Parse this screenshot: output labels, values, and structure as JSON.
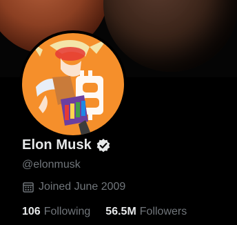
{
  "profile": {
    "display_name": "Elon Musk",
    "handle": "@elonmusk",
    "joined": "Joined June 2009",
    "verified_icon": "verified-badge-icon",
    "calendar_icon": "calendar-icon"
  },
  "stats": {
    "following_count": "106",
    "following_label": "Following",
    "followers_count": "56.5M",
    "followers_label": "Followers"
  },
  "colors": {
    "background": "#000000",
    "text_primary": "#e7e9ea",
    "text_secondary": "#71767b",
    "avatar_orange": "#f58f2b",
    "banner_planet": "#8b3f22"
  }
}
